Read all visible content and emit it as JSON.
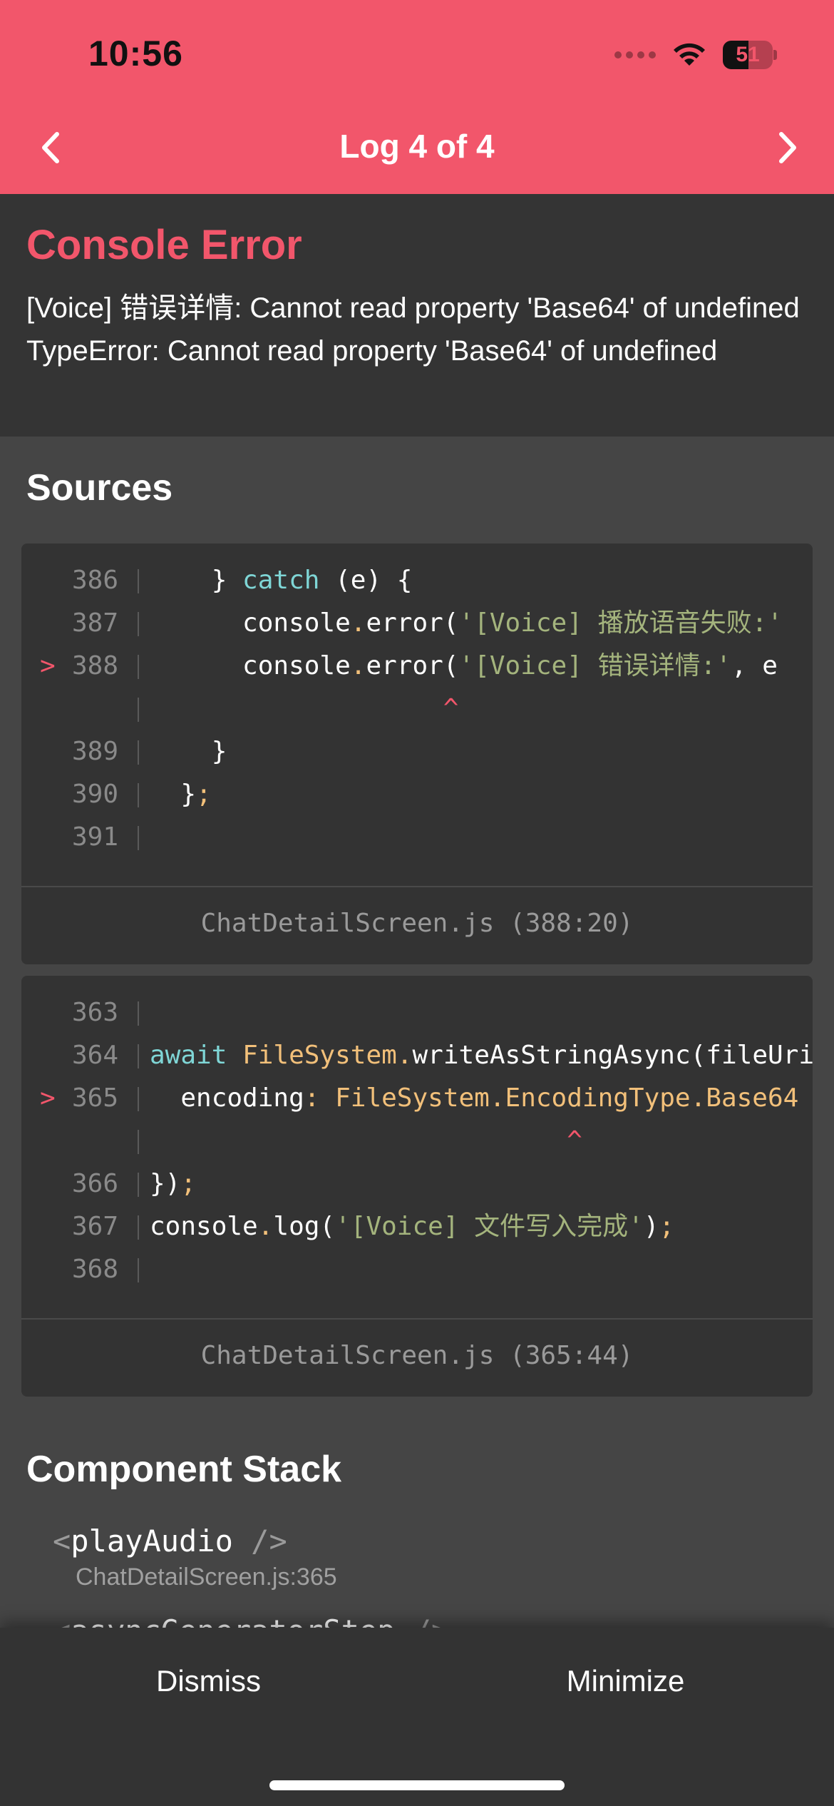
{
  "status_bar": {
    "time": "10:56",
    "battery_level": "51"
  },
  "nav": {
    "title": "Log 4 of 4"
  },
  "error": {
    "title": "Console Error",
    "message": "[Voice] 错误详情: Cannot read property 'Base64' of undefined TypeError: Cannot read property 'Base64' of undefined"
  },
  "sources": {
    "title": "Sources",
    "frames": [
      {
        "file": "ChatDetailScreen.js (388:20)",
        "lines": [
          {
            "marker": "",
            "num": "386",
            "tokens": [
              {
                "t": "    } ",
                "c": ""
              },
              {
                "t": "catch",
                "c": "kw"
              },
              {
                "t": " (e) {",
                "c": ""
              }
            ]
          },
          {
            "marker": "",
            "num": "387",
            "tokens": [
              {
                "t": "      console",
                "c": ""
              },
              {
                "t": ".",
                "c": "punc"
              },
              {
                "t": "error(",
                "c": ""
              },
              {
                "t": "'[Voice] 播放语音失败:'",
                "c": "str"
              }
            ]
          },
          {
            "marker": ">",
            "num": "388",
            "tokens": [
              {
                "t": "      console",
                "c": ""
              },
              {
                "t": ".",
                "c": "punc"
              },
              {
                "t": "error(",
                "c": ""
              },
              {
                "t": "'[Voice] 错误详情:'",
                "c": "str"
              },
              {
                "t": ", e",
                "c": ""
              }
            ]
          },
          {
            "marker": "",
            "num": "",
            "tokens": [
              {
                "t": "                   ^",
                "c": "caret"
              }
            ]
          },
          {
            "marker": "",
            "num": "389",
            "tokens": [
              {
                "t": "    }",
                "c": ""
              }
            ]
          },
          {
            "marker": "",
            "num": "390",
            "tokens": [
              {
                "t": "  }",
                "c": ""
              },
              {
                "t": ";",
                "c": "punc"
              }
            ]
          },
          {
            "marker": "",
            "num": "391",
            "tokens": [
              {
                "t": "",
                "c": ""
              }
            ]
          }
        ]
      },
      {
        "file": "ChatDetailScreen.js (365:44)",
        "lines": [
          {
            "marker": "",
            "num": "363",
            "tokens": [
              {
                "t": "",
                "c": ""
              }
            ]
          },
          {
            "marker": "",
            "num": "364",
            "tokens": [
              {
                "t": "await",
                "c": "kw"
              },
              {
                "t": " ",
                "c": ""
              },
              {
                "t": "FileSystem",
                "c": "obj"
              },
              {
                "t": ".",
                "c": "punc"
              },
              {
                "t": "writeAsStringAsync(fileUri",
                "c": ""
              }
            ]
          },
          {
            "marker": ">",
            "num": "365",
            "tokens": [
              {
                "t": "  encoding",
                "c": ""
              },
              {
                "t": ": ",
                "c": "punc"
              },
              {
                "t": "FileSystem.EncodingType.Base64",
                "c": "obj"
              }
            ]
          },
          {
            "marker": "",
            "num": "",
            "tokens": [
              {
                "t": "                           ^",
                "c": "caret"
              }
            ]
          },
          {
            "marker": "",
            "num": "366",
            "tokens": [
              {
                "t": "})",
                "c": ""
              },
              {
                "t": ";",
                "c": "punc"
              }
            ]
          },
          {
            "marker": "",
            "num": "367",
            "tokens": [
              {
                "t": "console",
                "c": ""
              },
              {
                "t": ".",
                "c": "punc"
              },
              {
                "t": "log(",
                "c": ""
              },
              {
                "t": "'[Voice] 文件写入完成'",
                "c": "str"
              },
              {
                "t": ")",
                "c": ""
              },
              {
                "t": ";",
                "c": "punc"
              }
            ]
          },
          {
            "marker": "",
            "num": "368",
            "tokens": [
              {
                "t": "",
                "c": ""
              }
            ]
          }
        ]
      }
    ]
  },
  "component_stack": {
    "title": "Component Stack",
    "items": [
      {
        "name": "playAudio",
        "open": "<",
        "close": " />",
        "location": "ChatDetailScreen.js:365"
      },
      {
        "name": "asyncGeneratorStep",
        "open": "<",
        "close": " />",
        "location": ""
      }
    ]
  },
  "footer": {
    "dismiss_label": "Dismiss",
    "minimize_label": "Minimize"
  },
  "colors": {
    "accent": "#f2566b",
    "background": "#454545",
    "panel": "#333333"
  },
  "icons": {
    "back": "chevron-left-icon",
    "forward": "chevron-right-icon",
    "wifi": "wifi-icon",
    "battery": "battery-icon",
    "signal": "cellular-signal-icon"
  }
}
